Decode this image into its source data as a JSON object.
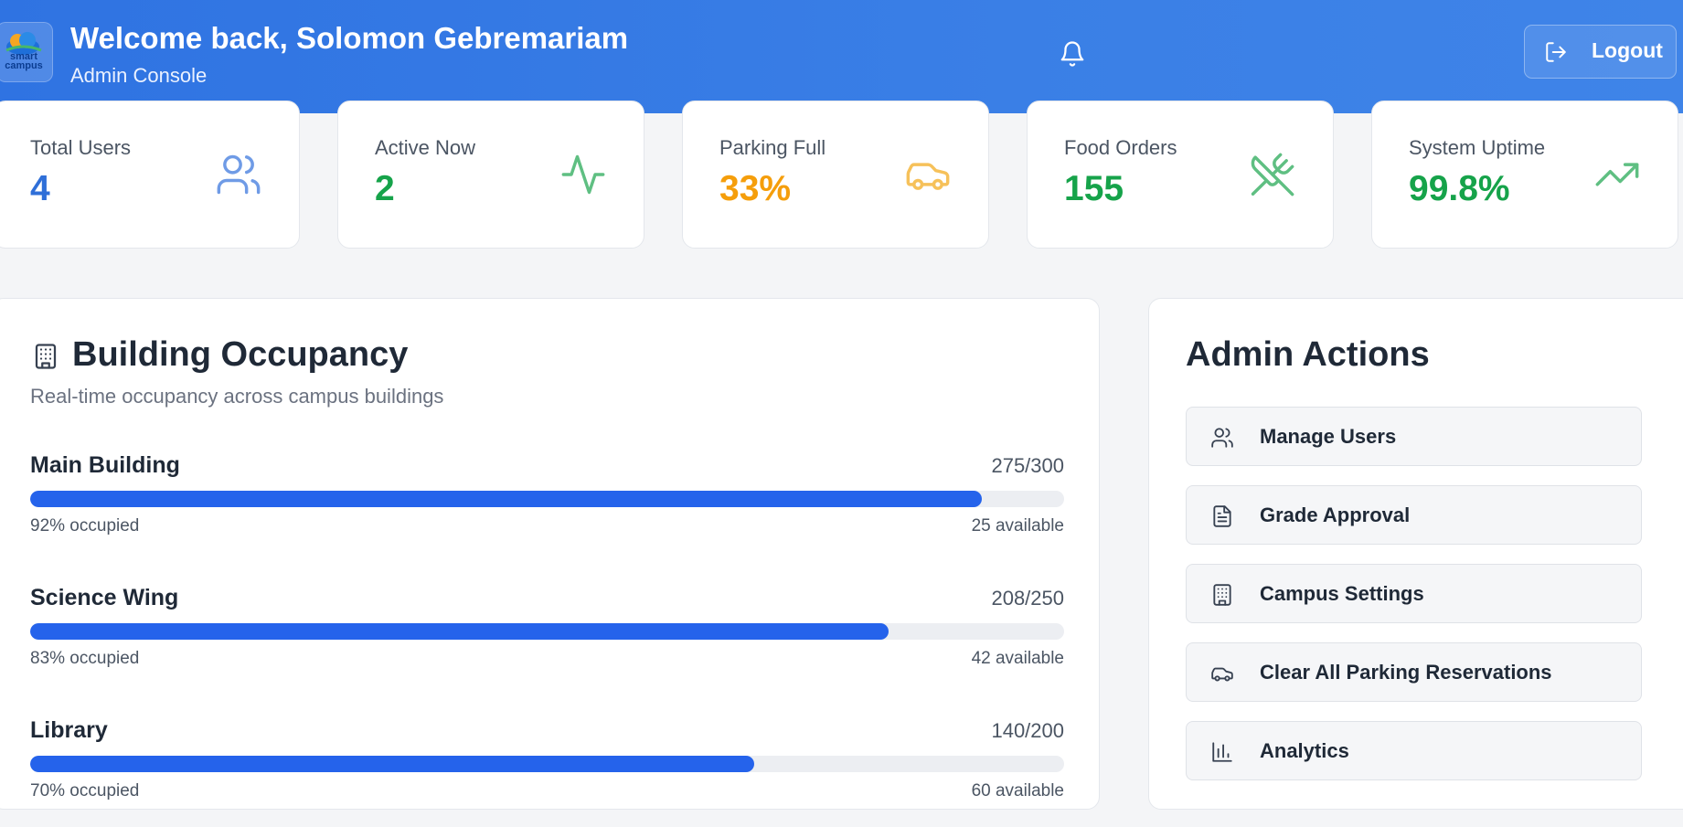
{
  "header": {
    "logo_text": "smart campus",
    "welcome": "Welcome back, Solomon Gebremariam",
    "subtitle": "Admin Console",
    "logout_label": "Logout"
  },
  "stats": [
    {
      "label": "Total Users",
      "value": "4",
      "color": "#2f6fd8",
      "icon": "users-icon"
    },
    {
      "label": "Active Now",
      "value": "2",
      "color": "#16a34a",
      "icon": "activity-icon"
    },
    {
      "label": "Parking Full",
      "value": "33%",
      "color": "#f59e0b",
      "icon": "car-icon"
    },
    {
      "label": "Food Orders",
      "value": "155",
      "color": "#16a34a",
      "icon": "utensils-icon"
    },
    {
      "label": "System Uptime",
      "value": "99.8%",
      "color": "#16a34a",
      "icon": "trending-up-icon"
    }
  ],
  "occupancy": {
    "title": "Building Occupancy",
    "subtitle": "Real-time occupancy across campus buildings",
    "buildings": [
      {
        "name": "Main Building",
        "count": "275/300",
        "percent": 92,
        "occupied_label": "92% occupied",
        "available_label": "25 available"
      },
      {
        "name": "Science Wing",
        "count": "208/250",
        "percent": 83,
        "occupied_label": "83% occupied",
        "available_label": "42 available"
      },
      {
        "name": "Library",
        "count": "140/200",
        "percent": 70,
        "occupied_label": "70% occupied",
        "available_label": "60 available"
      }
    ]
  },
  "admin_actions": {
    "title": "Admin Actions",
    "items": [
      {
        "label": "Manage Users",
        "icon": "users-icon"
      },
      {
        "label": "Grade Approval",
        "icon": "document-icon"
      },
      {
        "label": "Campus Settings",
        "icon": "building-icon"
      },
      {
        "label": "Clear All Parking Reservations",
        "icon": "car-icon"
      },
      {
        "label": "Analytics",
        "icon": "bar-chart-icon"
      }
    ]
  },
  "colors": {
    "header": "#3079e4",
    "accent": "#2563eb",
    "success": "#16a34a",
    "warning": "#f59e0b"
  }
}
